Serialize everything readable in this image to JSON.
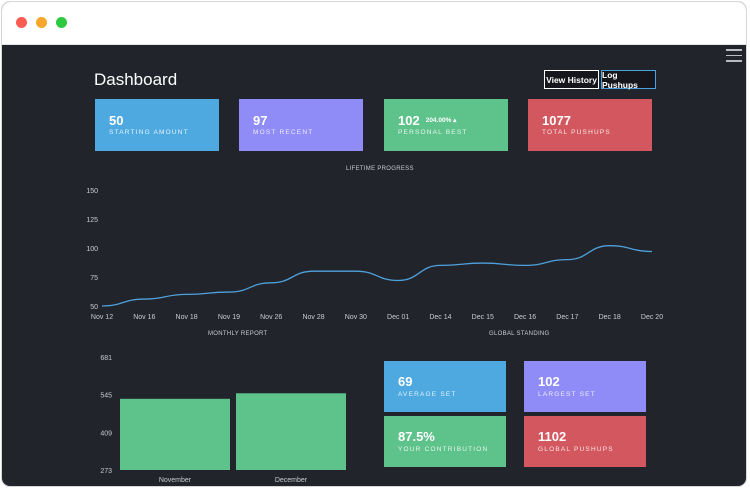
{
  "header": {
    "title": "Dashboard",
    "buttons": {
      "history": "View History",
      "log": "Log Pushups"
    }
  },
  "colors": {
    "blue": "#4da9e0",
    "purple": "#8f8cf8",
    "green": "#5ec28b",
    "red": "#d3575f",
    "line": "#4fa1dc",
    "background": "#21242b"
  },
  "stats": [
    {
      "value": "50",
      "label": "Starting Amount",
      "color": "#4da9e0"
    },
    {
      "value": "97",
      "label": "Most Recent",
      "color": "#8f8cf8"
    },
    {
      "value": "102",
      "label": "Personal Best",
      "extra": "204.00% ▴",
      "color": "#5ec28b"
    },
    {
      "value": "1077",
      "label": "Total Pushups",
      "color": "#d3575f"
    }
  ],
  "global": [
    {
      "value": "69",
      "label": "Average Set",
      "color": "#4da9e0"
    },
    {
      "value": "102",
      "label": "Largest Set",
      "color": "#8f8cf8"
    },
    {
      "value": "87.5%",
      "label": "Your Contribution",
      "color": "#5ec28b"
    },
    {
      "value": "1102",
      "label": "Global Pushups",
      "color": "#d3575f"
    }
  ],
  "sections": {
    "lifetime": "Lifetime Progress",
    "monthly": "Monthly Report",
    "global": "Global Standing"
  },
  "chart_data": [
    {
      "type": "line",
      "title": "Lifetime Progress",
      "x": [
        "Nov 12",
        "Nov 16",
        "Nov 18",
        "Nov 19",
        "Nov 26",
        "Nov 28",
        "Nov 30",
        "Dec 01",
        "Dec 14",
        "Dec 15",
        "Dec 16",
        "Dec 17",
        "Dec 18",
        "Dec 20"
      ],
      "values": [
        50,
        56,
        60,
        62,
        70,
        80,
        80,
        72,
        85,
        87,
        85,
        90,
        102,
        97
      ],
      "yticks": [
        150,
        125,
        100,
        75,
        50
      ],
      "ylim": [
        50,
        150
      ],
      "color": "#4fa1dc"
    },
    {
      "type": "bar",
      "title": "Monthly Report",
      "categories": [
        "November",
        "December"
      ],
      "values": [
        530,
        550
      ],
      "yticks": [
        681,
        545,
        409,
        273
      ],
      "ylim": [
        273,
        681
      ],
      "color": "#5ec28b"
    }
  ]
}
